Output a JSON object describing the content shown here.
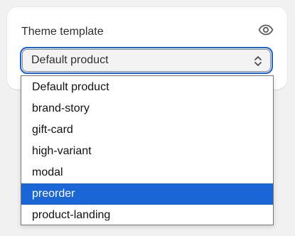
{
  "field": {
    "label": "Theme template",
    "value": "Default product",
    "visibility_icon": "eye-icon",
    "chevron_icon": "select-chevron-icon"
  },
  "dropdown": {
    "options": [
      "Default product",
      "brand-story",
      "gift-card",
      "high-variant",
      "modal",
      "preorder",
      "product-landing"
    ],
    "highlighted": "preorder"
  },
  "colors": {
    "accent": "#1b66d6",
    "text": "#303030"
  }
}
